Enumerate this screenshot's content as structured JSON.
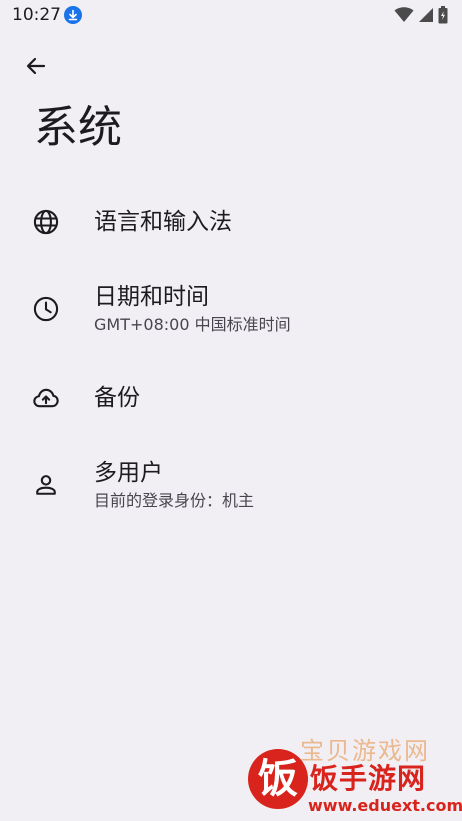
{
  "status_bar": {
    "time": "10:27",
    "icons": [
      "download-icon",
      "wifi-icon",
      "signal-icon",
      "battery-icon"
    ]
  },
  "header": {
    "back_icon": "arrow-back-icon",
    "title": "系统"
  },
  "settings": {
    "items": [
      {
        "icon": "globe-icon",
        "title": "语言和输入法",
        "summary": ""
      },
      {
        "icon": "clock-icon",
        "title": "日期和时间",
        "summary": "GMT+08:00 中国标准时间"
      },
      {
        "icon": "cloud-upload-icon",
        "title": "备份",
        "summary": ""
      },
      {
        "icon": "person-icon",
        "title": "多用户",
        "summary": "目前的登录身份：机主"
      }
    ]
  },
  "watermark": {
    "logo_char": "饭",
    "top_text": "宝贝游戏网",
    "main_text": "饭手游网",
    "url": "www.eduext.com"
  },
  "colors": {
    "background": "#f1eff4",
    "text_primary": "#1c1b1f",
    "text_secondary": "#49454f",
    "download_badge": "#1a73e8",
    "watermark_red": "#d8241c"
  }
}
